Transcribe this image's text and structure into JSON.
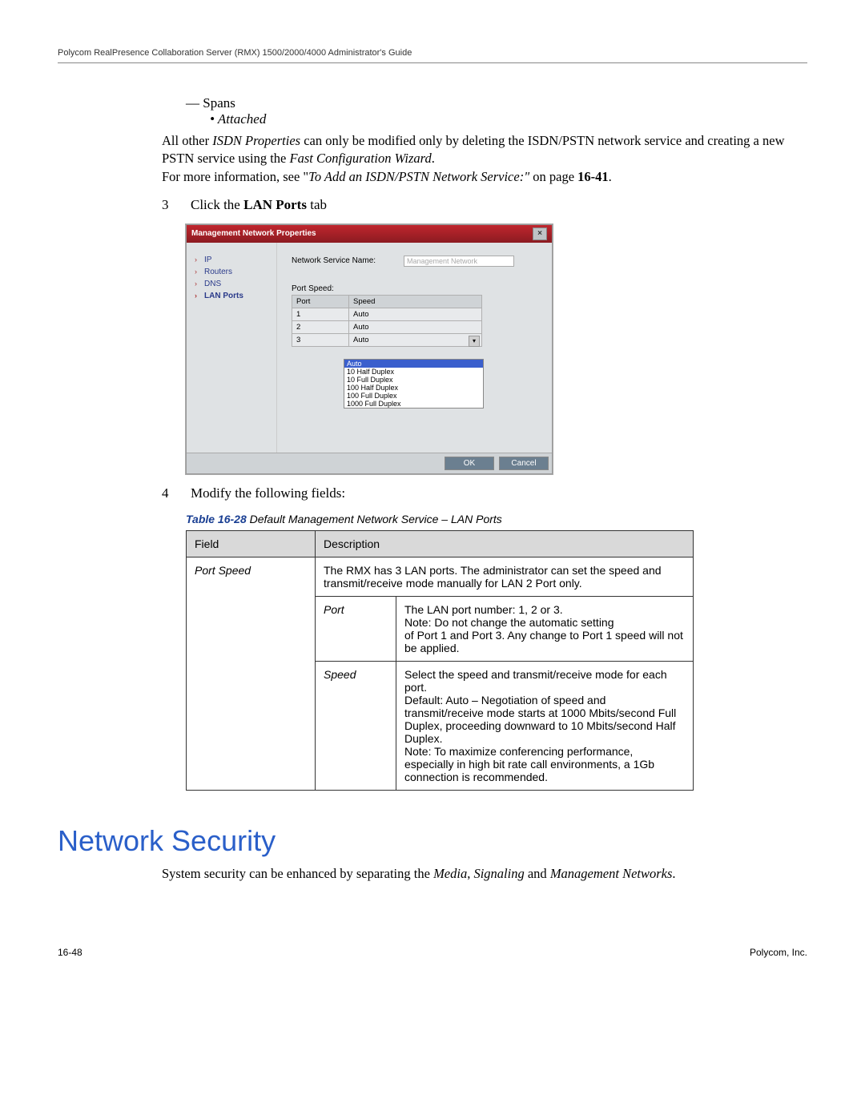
{
  "header": {
    "guide_title": "Polycom RealPresence Collaboration Server (RMX) 1500/2000/4000 Administrator's Guide"
  },
  "content": {
    "spans_label": "— Spans",
    "attached_label": "• Attached",
    "isdn_para_pre": "All other ",
    "isdn_props": "ISDN Properties",
    "isdn_para_post": " can only be modified only by deleting the ISDN/PSTN network service and creating a new PSTN service using the ",
    "fast_wizard": "Fast Configuration Wizard",
    "period": ".",
    "more_info_pre": "For more information, see \"",
    "more_info_ital": "To Add an ISDN/PSTN Network Service:\"",
    "more_info_post": " on page ",
    "more_info_page": "16-41",
    "step3_num": "3",
    "step3_pre": "Click the ",
    "step3_bold": "LAN Ports",
    "step3_post": " tab",
    "step4_num": "4",
    "step4_text": "Modify the following fields:"
  },
  "dialog": {
    "title": "Management Network Properties",
    "close": "×",
    "nav": {
      "ip": "IP",
      "routers": "Routers",
      "dns": "DNS",
      "lanports": "LAN Ports"
    },
    "svc_label": "Network Service Name:",
    "svc_value": "Management Network",
    "portspeed_label": "Port Speed:",
    "cols": {
      "port": "Port",
      "speed": "Speed"
    },
    "rows": [
      {
        "port": "1",
        "speed": "Auto"
      },
      {
        "port": "2",
        "speed": "Auto"
      },
      {
        "port": "3",
        "speed": "Auto"
      }
    ],
    "dd": [
      "Auto",
      "10 Half Duplex",
      "10 Full Duplex",
      "100 Half Duplex",
      "100 Full Duplex",
      "1000 Full Duplex"
    ],
    "ok": "OK",
    "cancel": "Cancel"
  },
  "table": {
    "caption_bold": "Table 16-28",
    "caption_rest": " Default Management Network Service – LAN Ports",
    "h_field": "Field",
    "h_desc": "Description",
    "portspeed_field": "Port Speed",
    "portspeed_desc": "The RMX has 3 LAN ports. The administrator can set the speed and transmit/receive mode manually for LAN 2 Port only.",
    "port_field": "Port",
    "port_desc": "The LAN port number: 1, 2 or 3.\nNote: Do not change the automatic setting\nof Port 1 and Port 3. Any change to Port 1 speed will not be applied.",
    "speed_field": "Speed",
    "speed_desc": "Select the speed and transmit/receive mode for each port.\nDefault: Auto – Negotiation of speed and transmit/receive mode starts at 1000 Mbits/second Full Duplex, proceeding downward to 10 Mbits/second Half Duplex.\nNote: To maximize conferencing performance, especially in high bit rate call environments, a 1Gb connection is recommended."
  },
  "section": {
    "title": "Network Security",
    "para_pre": "System security can be enhanced by separating the ",
    "para_ital1": "Media",
    "para_mid1": ", ",
    "para_ital2": "Signaling",
    "para_mid2": " and ",
    "para_ital3": "Management Networks",
    "para_post": "."
  },
  "footer": {
    "pagenum": "16-48",
    "company": "Polycom, Inc."
  }
}
